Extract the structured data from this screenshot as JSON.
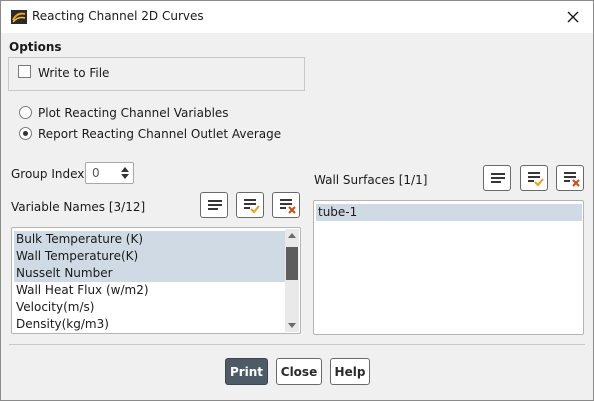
{
  "window": {
    "title": "Reacting Channel 2D Curves"
  },
  "options": {
    "label": "Options",
    "write_to_file": {
      "label": "Write to File",
      "checked": false
    }
  },
  "mode": {
    "plot_label": "Plot Reacting Channel Variables",
    "report_label": "Report Reacting Channel Outlet Average",
    "selected": "report"
  },
  "group_index": {
    "label": "Group Index",
    "value": "0"
  },
  "variable_names": {
    "label": "Variable Names [3/12]",
    "items": [
      {
        "text": "Bulk Temperature (K)",
        "selected": true
      },
      {
        "text": "Wall Temperature(K)",
        "selected": true
      },
      {
        "text": "Nusselt Number",
        "selected": true
      },
      {
        "text": "Wall Heat Flux (w/m2)",
        "selected": false
      },
      {
        "text": "Velocity(m/s)",
        "selected": false
      },
      {
        "text": "Density(kg/m3)",
        "selected": false
      }
    ]
  },
  "wall_surfaces": {
    "label": "Wall Surfaces [1/1]",
    "items": [
      {
        "text": "tube-1",
        "selected": true
      }
    ]
  },
  "buttons": {
    "print": "Print",
    "close": "Close",
    "help": "Help"
  },
  "colors": {
    "selection": "#d0dae4",
    "primary_button": "#4e5a66",
    "check_accent": "#e3a41b",
    "clear_accent": "#d04a12"
  },
  "icons": {
    "list_all": "list-lines-icon",
    "select_all": "list-check-icon",
    "deselect_all": "list-clear-icon"
  }
}
